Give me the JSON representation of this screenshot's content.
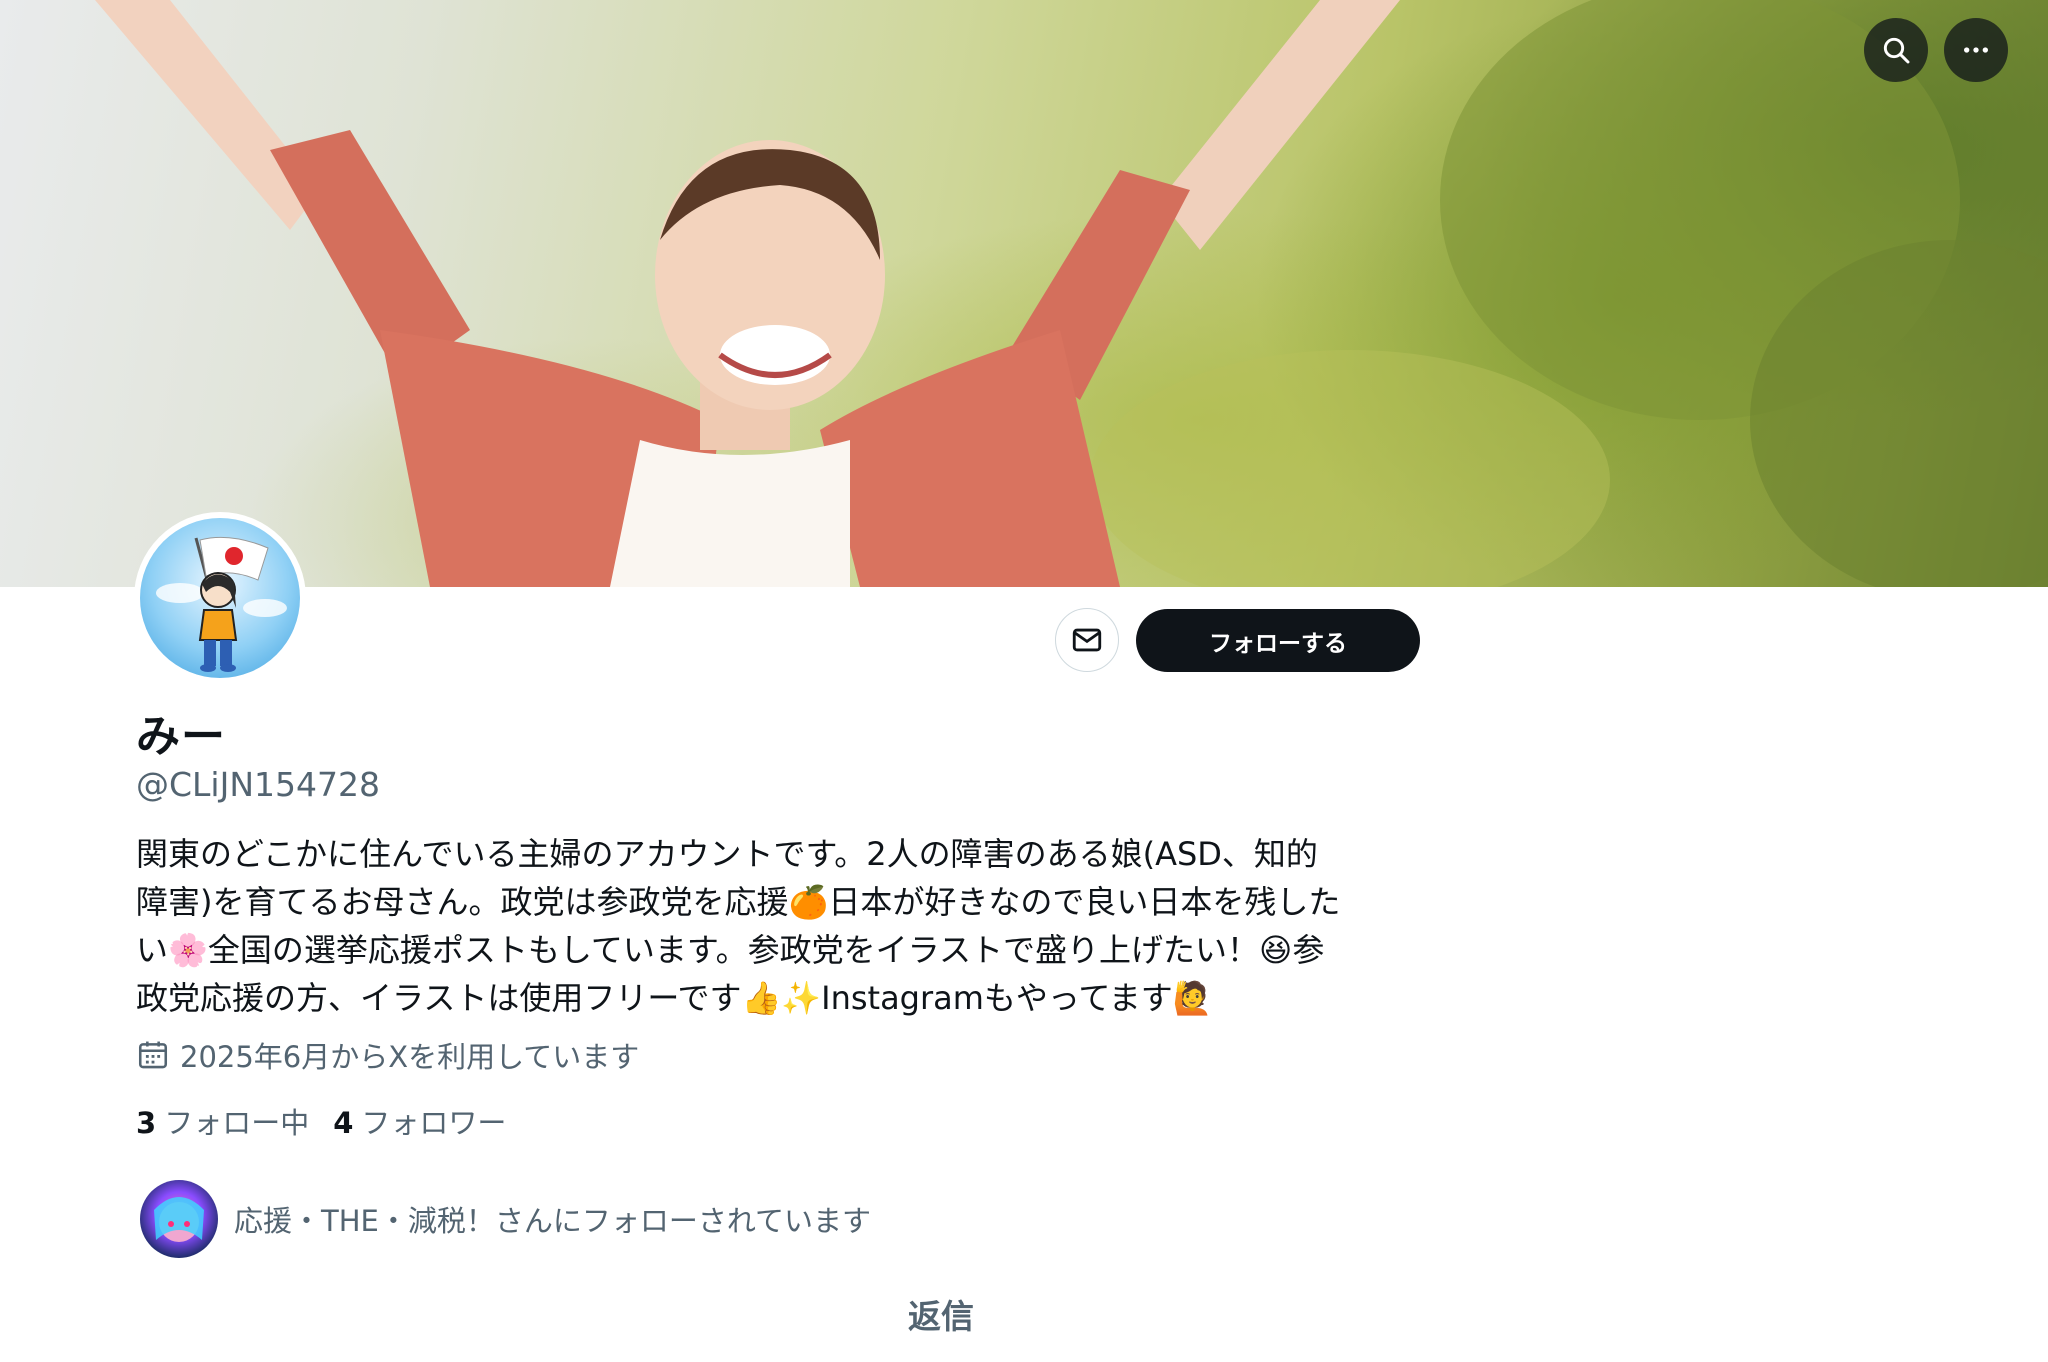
{
  "banner": {
    "search_icon": "search-icon",
    "more_icon": "more-horizontal-icon"
  },
  "profile": {
    "display_name": "みー",
    "handle": "@CLiJN154728",
    "bio": "関東のどこかに住んでいる主婦のアカウントです。2人の障害のある娘(ASD、知的\n障害)を育てるお母さん。政党は参政党を応援🍊日本が好きなので良い日本を残した\nい🌸全国の選挙応援ポストもしています。参政党をイラストで盛り上げたい！😆参\n政党応援の方、イラストは使用フリーです👍✨Instagramもやってます🙋",
    "joined": "2025年6月からXを利用しています",
    "following_count": "3",
    "following_label": "フォロー中",
    "followers_count": "4",
    "followers_label": "フォロワー",
    "followed_by": "応援・THE・減税！さんにフォローされています"
  },
  "actions": {
    "message_icon": "mail-icon",
    "follow_label": "フォローする"
  },
  "tabs": {
    "replies_label": "返信"
  },
  "colors": {
    "primary_text": "#0f1419",
    "secondary_text": "#536471",
    "follow_button_bg": "#0f1419",
    "border": "#cfd9de"
  }
}
